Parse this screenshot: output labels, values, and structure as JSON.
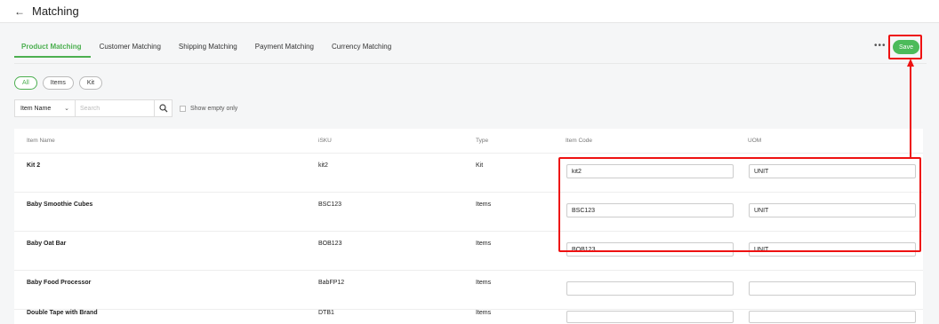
{
  "header": {
    "title": "Matching"
  },
  "tabs": [
    {
      "label": "Product Matching",
      "active": true
    },
    {
      "label": "Customer Matching",
      "active": false
    },
    {
      "label": "Shipping Matching",
      "active": false
    },
    {
      "label": "Payment Matching",
      "active": false
    },
    {
      "label": "Currency Matching",
      "active": false
    }
  ],
  "toolbar": {
    "more_label": "•••",
    "save_label": "Save"
  },
  "chips": [
    {
      "label": "All",
      "active": true
    },
    {
      "label": "Items",
      "active": false
    },
    {
      "label": "Kit",
      "active": false
    }
  ],
  "filter": {
    "field_label": "Item Name",
    "search_placeholder": "Search",
    "show_empty_label": "Show empty only"
  },
  "table": {
    "columns": [
      "Item Name",
      "iSKU",
      "Type",
      "Item Code",
      "UOM"
    ],
    "rows": [
      {
        "name": "Kit 2",
        "isku": "kit2",
        "type": "Kit",
        "item_code": "kit2",
        "uom": "UNIT"
      },
      {
        "name": "Baby Smoothie Cubes",
        "isku": "BSC123",
        "type": "Items",
        "item_code": "BSC123",
        "uom": "UNIT"
      },
      {
        "name": "Baby Oat Bar",
        "isku": "BOB123",
        "type": "Items",
        "item_code": "BOB123",
        "uom": "UNIT"
      },
      {
        "name": "Baby Food Processor",
        "isku": "BabFP12",
        "type": "Items",
        "item_code": "",
        "uom": ""
      },
      {
        "name": "Double Tape with Brand",
        "isku": "DTB1",
        "type": "Items",
        "item_code": "",
        "uom": ""
      }
    ]
  },
  "colors": {
    "accent": "#4caf50",
    "save": "#4cbb5a",
    "annotation": "#ee1111"
  }
}
